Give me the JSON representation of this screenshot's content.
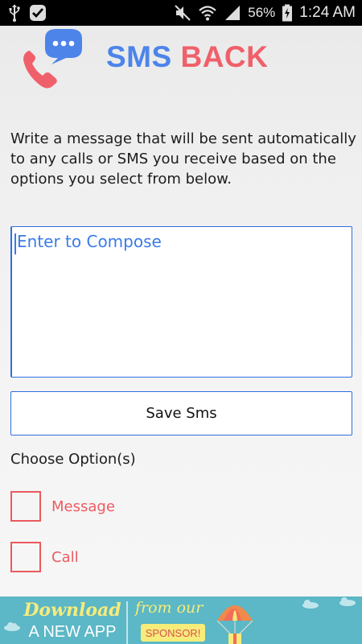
{
  "status_bar": {
    "battery_percent": "56%",
    "time": "1:24 AM",
    "icons_left": [
      "usb-icon",
      "check-notification-icon"
    ],
    "icons_right": [
      "mute-icon",
      "wifi-icon",
      "signal-icon",
      "battery-charging-icon"
    ]
  },
  "header": {
    "title_part1": "SMS",
    "title_part2": "BACK",
    "logo_icon": "phone-chat-logo-icon"
  },
  "description": "Write a message that will be sent automatically to any calls or SMS you receive based on the options you select from below.",
  "compose": {
    "placeholder": "Enter to Compose",
    "value": ""
  },
  "save_button_label": "Save Sms",
  "options": {
    "heading": "Choose Option(s)",
    "items": [
      {
        "label": "Message",
        "checked": false
      },
      {
        "label": "Call",
        "checked": false
      }
    ]
  },
  "ad": {
    "left_text": "Download",
    "left_sub": "A NEW APP",
    "mid_text": "from our",
    "sponsor": "SPONSOR!"
  },
  "colors": {
    "accent_blue": "#4d84ea",
    "accent_red": "#f0606a",
    "input_border": "#2f6ee0",
    "ad_bg": "#5cb7c6"
  }
}
